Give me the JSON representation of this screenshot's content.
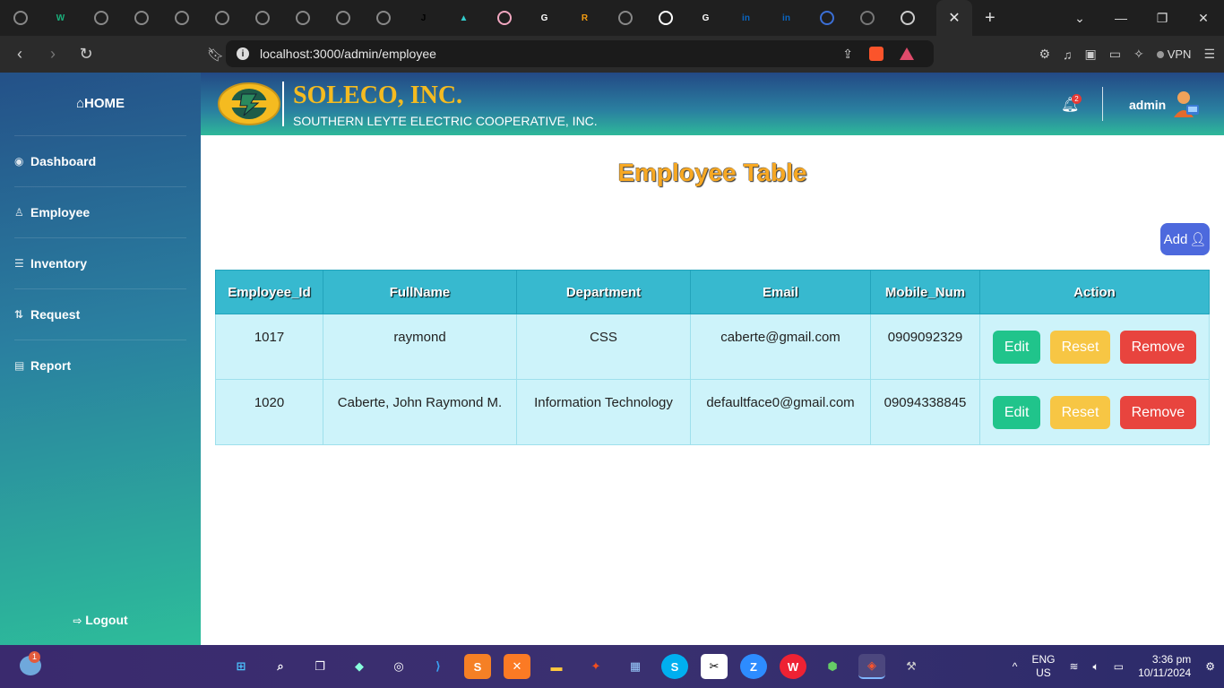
{
  "browser": {
    "url": "localhost:3000/admin/employee",
    "vpn_label": "VPN",
    "tabs": [
      {
        "icon": "globe-icon",
        "color": "#888"
      },
      {
        "icon": "w-icon",
        "color": "#1ab17c",
        "glyph": "W"
      },
      {
        "icon": "globe-icon",
        "color": "#888"
      },
      {
        "icon": "globe-icon",
        "color": "#888"
      },
      {
        "icon": "globe-icon",
        "color": "#888"
      },
      {
        "icon": "globe-icon",
        "color": "#888"
      },
      {
        "icon": "globe-icon",
        "color": "#888"
      },
      {
        "icon": "globe-icon",
        "color": "#888"
      },
      {
        "icon": "globe-icon",
        "color": "#888"
      },
      {
        "icon": "globe-icon",
        "color": "#888"
      },
      {
        "icon": "j-icon",
        "color": "#000",
        "glyph": "J"
      },
      {
        "icon": "triangle-icon",
        "color": "#3cc",
        "glyph": "▲"
      },
      {
        "icon": "avatar-icon",
        "color": "#f1a7c0"
      },
      {
        "icon": "google-icon",
        "color": "#fff",
        "glyph": "G"
      },
      {
        "icon": "r-icon",
        "color": "#f39c12",
        "glyph": "R"
      },
      {
        "icon": "globe-icon",
        "color": "#888"
      },
      {
        "icon": "github-icon",
        "color": "#fff"
      },
      {
        "icon": "google-icon",
        "color": "#fff",
        "glyph": "G"
      },
      {
        "icon": "linkedin-icon",
        "color": "#0a66c2",
        "glyph": "in"
      },
      {
        "icon": "linkedin-icon",
        "color": "#0a66c2",
        "glyph": "in"
      },
      {
        "icon": "earth-icon",
        "color": "#3b6fd6"
      },
      {
        "icon": "openai-icon",
        "color": "#777"
      },
      {
        "icon": "speaker-icon",
        "color": "#ccc"
      }
    ]
  },
  "sidebar": {
    "home_label": "HOME",
    "items": [
      {
        "label": "Dashboard",
        "icon": "palette-icon"
      },
      {
        "label": "Employee",
        "icon": "user-icon"
      },
      {
        "label": "Inventory",
        "icon": "list-icon"
      },
      {
        "label": "Request",
        "icon": "pull-request-icon"
      },
      {
        "label": "Report",
        "icon": "file-icon"
      }
    ],
    "logout_label": "Logout"
  },
  "header": {
    "company_name": "SOLECO, INC.",
    "company_full": "SOUTHERN LEYTE ELECTRIC COOPERATIVE, INC.",
    "notification_count": "2",
    "username": "admin"
  },
  "main": {
    "page_title": "Employee Table",
    "add_label": "Add",
    "columns": [
      "Employee_Id",
      "FullName",
      "Department",
      "Email",
      "Mobile_Num",
      "Action"
    ],
    "rows": [
      {
        "id": "1017",
        "name": "raymond",
        "department": "CSS",
        "email": "caberte@gmail.com",
        "mobile": "0909092329"
      },
      {
        "id": "1020",
        "name": "Caberte, John Raymond M.",
        "department": "Information Technology",
        "email": "defaultface0@gmail.com",
        "mobile": "09094338845"
      }
    ],
    "actions": {
      "edit": "Edit",
      "reset": "Reset",
      "remove": "Remove"
    }
  },
  "taskbar": {
    "weather_badge": "1",
    "lang_line1": "ENG",
    "lang_line2": "US",
    "time": "3:36 pm",
    "date": "10/11/2024"
  },
  "colors": {
    "accent_title": "#f7a823",
    "table_header": "#37b9cf",
    "table_row": "#cdf3fa",
    "edit": "#20c48b",
    "reset": "#f7c644",
    "remove": "#e8443e",
    "add": "#4d69dd"
  }
}
